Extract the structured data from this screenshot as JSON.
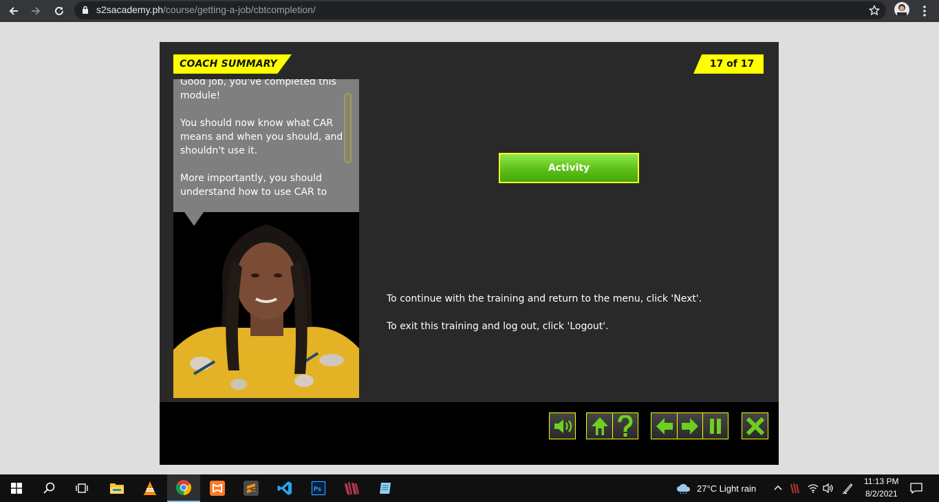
{
  "browser": {
    "url_host": "s2sacademy.ph",
    "url_path": "/course/getting-a-job/cbtcompletion/"
  },
  "course": {
    "section_title": "COACH SUMMARY",
    "page_counter": "17 of 17",
    "speech_paragraphs": [
      "Good job, you've completed this module!",
      "You should now know what CAR means and when you should, and shouldn't use it.",
      "More importantly, you should understand how to use CAR to"
    ],
    "activity_label": "Activity",
    "instruction_next": "To continue with the training and return to the menu, click 'Next'.",
    "instruction_logout": "To exit this training and log out, click 'Logout'."
  },
  "taskbar": {
    "weather": "27°C  Light rain",
    "time": "11:13 PM",
    "date": "8/2/2021"
  },
  "colors": {
    "accent_yellow": "#ffff00",
    "activity_green": "#5cc117",
    "nav_icon_green": "#6fcf1e"
  },
  "icons": [
    "back-icon",
    "forward-icon",
    "reload-icon",
    "lock-icon",
    "star-icon",
    "menu-icon",
    "audio-icon",
    "home-icon",
    "help-icon",
    "previous-icon",
    "next-icon",
    "pause-icon",
    "close-icon",
    "windows-start-icon",
    "search-icon",
    "task-view-icon",
    "file-explorer-icon",
    "vlc-icon",
    "chrome-icon",
    "xampp-icon",
    "sublime-icon",
    "vscode-icon",
    "photoshop-icon",
    "winrar-icon",
    "notepad-icon",
    "cloud-icon",
    "chevron-up-icon",
    "wifi-icon",
    "volume-icon",
    "pen-icon",
    "notifications-icon"
  ]
}
